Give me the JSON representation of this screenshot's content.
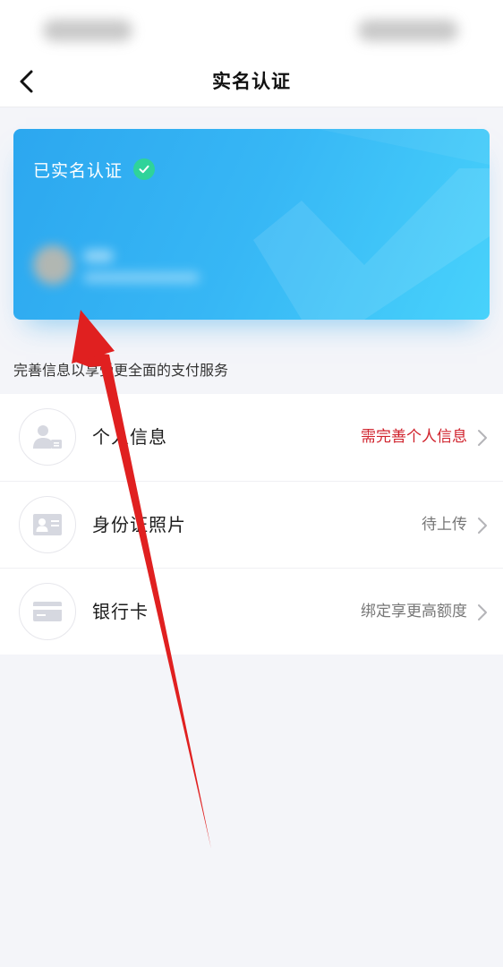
{
  "header": {
    "title": "实名认证",
    "back_icon": "chevron-left-icon"
  },
  "card": {
    "status_text": "已实名认证",
    "check_icon": "check-circle-icon",
    "colors": {
      "start": "#2ca7ef",
      "end": "#48d2fb",
      "badge": "#2fd39a"
    }
  },
  "hint": "完善信息以享受更全面的支付服务",
  "items": [
    {
      "label": "个人信息",
      "status": "需完善个人信息",
      "icon": "person-card-icon",
      "status_color": "#d0222c"
    },
    {
      "label": "身份证照片",
      "status": "待上传",
      "icon": "id-card-icon",
      "status_color": "#777777"
    },
    {
      "label": "银行卡",
      "status": "绑定享更高额度",
      "icon": "bank-card-icon",
      "status_color": "#777777"
    }
  ],
  "annotation": {
    "arrow_color": "#e02020"
  }
}
